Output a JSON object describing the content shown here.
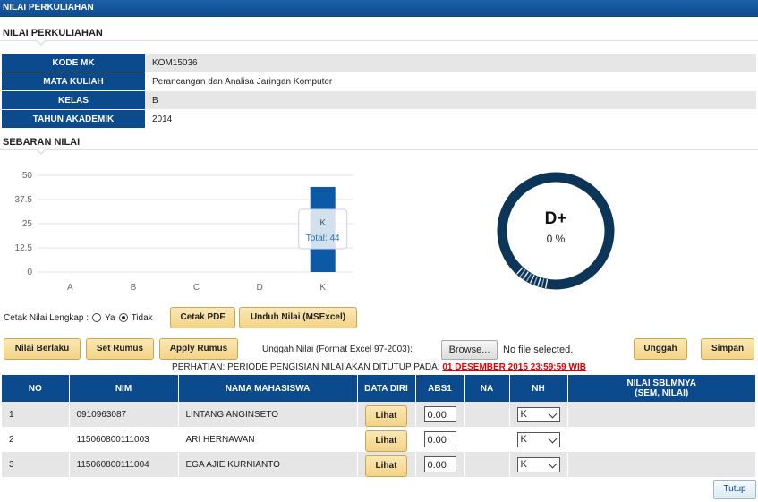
{
  "header": {
    "title": "NILAI PERKULIAHAN"
  },
  "section_nilai": {
    "title": "NILAI PERKULIAHAN"
  },
  "info": [
    {
      "label": "KODE MK",
      "value": "KOM15036"
    },
    {
      "label": "MATA KULIAH",
      "value": "Perancangan dan Analisa Jaringan Komputer"
    },
    {
      "label": "KELAS",
      "value": "B"
    },
    {
      "label": "TAHUN AKADEMIK",
      "value": "2014"
    }
  ],
  "section_sebaran": {
    "title": "SEBARAN NILAI"
  },
  "chart_data": {
    "type": "bar",
    "categories": [
      "A",
      "B",
      "C",
      "D",
      "K"
    ],
    "values": [
      0,
      0,
      0,
      0,
      44
    ],
    "yticks": [
      "0",
      "12.5",
      "25",
      "37.5",
      "50"
    ],
    "ylim": [
      0,
      50
    ],
    "tooltip": {
      "category": "K",
      "text": "Total: 44"
    },
    "bar_color": "#0c5aa6"
  },
  "donut": {
    "grade": "D+",
    "percent": "0 %",
    "color": "#0d3557"
  },
  "cetak": {
    "label": "Cetak Nilai Lengkap :",
    "opt_ya": "Ya",
    "opt_tidak": "Tidak",
    "selected": "Tidak",
    "pdf_button": "Cetak PDF",
    "excel_button": "Unduh Nilai (MSExcel)"
  },
  "toolbar": {
    "nilai_berlaku": "Nilai Berlaku",
    "set_rumus": "Set Rumus",
    "apply_rumus": "Apply Rumus",
    "upload_label": "Unggah Nilai (Format Excel 97-2003):",
    "browse": "Browse...",
    "no_file": "No file selected.",
    "unggah": "Unggah",
    "simpan": "Simpan"
  },
  "warning": {
    "text": "PERHATIAN: PERIODE PENGISIAN NILAI AKAN DITUTUP PADA:",
    "date": "01 DESEMBER 2015 23:59:59 WIB"
  },
  "table": {
    "headers": {
      "no": "NO",
      "nim": "NIM",
      "nama": "NAMA MAHASISWA",
      "data_diri": "DATA DIRI",
      "abs1": "ABS1",
      "na": "NA",
      "nh": "NH",
      "nilai_sblm_1": "NILAI SBLMNYA",
      "nilai_sblm_2": "(SEM, NILAI)"
    },
    "rows": [
      {
        "no": "1",
        "nim": "0910963087",
        "nama": "LINTANG ANGINSETO",
        "lihat": "Lihat",
        "abs1": "0.00",
        "nh": "K"
      },
      {
        "no": "2",
        "nim": "115060800111003",
        "nama": "ARI HERNAWAN",
        "lihat": "Lihat",
        "abs1": "0.00",
        "nh": "K"
      },
      {
        "no": "3",
        "nim": "115060800111004",
        "nama": "EGA AJIE KURNIANTO",
        "lihat": "Lihat",
        "abs1": "0.00",
        "nh": "K"
      }
    ]
  },
  "footer": {
    "tutup": "Tutup"
  }
}
